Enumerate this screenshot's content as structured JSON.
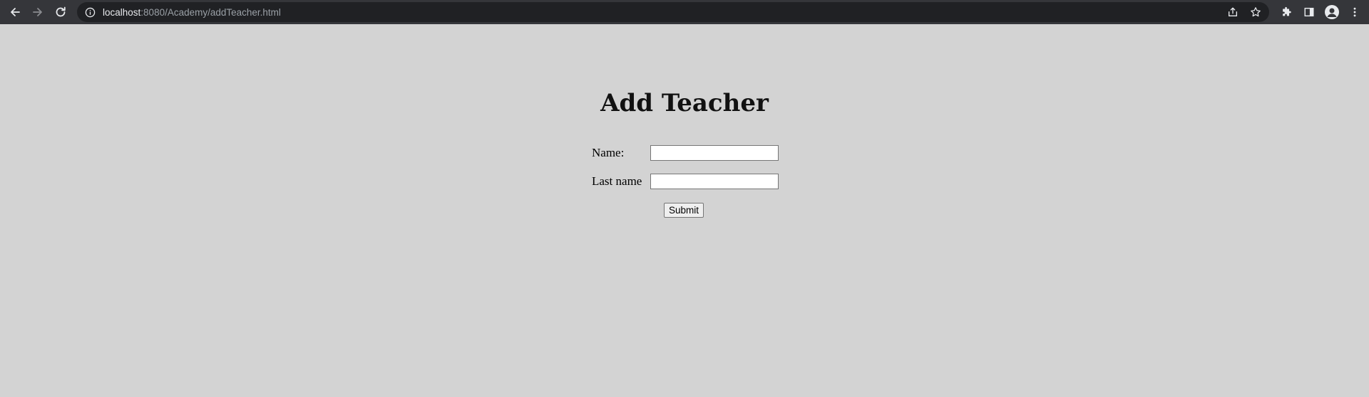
{
  "browser": {
    "url_host": "localhost",
    "url_rest": ":8080/Academy/addTeacher.html"
  },
  "page": {
    "title": "Add Teacher",
    "form": {
      "name_label": "Name:",
      "name_value": "",
      "lastname_label": "Last name",
      "lastname_value": "",
      "submit_label": "Submit"
    }
  },
  "colors": {
    "page_background": "#d3d3d3",
    "browser_toolbar": "#35363a",
    "omnibox": "#202124"
  },
  "icons": {
    "back": "arrow-left-icon",
    "forward": "arrow-right-icon",
    "reload": "reload-icon",
    "site_info": "info-icon",
    "share": "share-icon",
    "bookmark": "star-icon",
    "extensions": "puzzle-icon",
    "side_panel": "side-panel-icon",
    "profile": "profile-icon",
    "menu": "kebab-menu-icon"
  }
}
